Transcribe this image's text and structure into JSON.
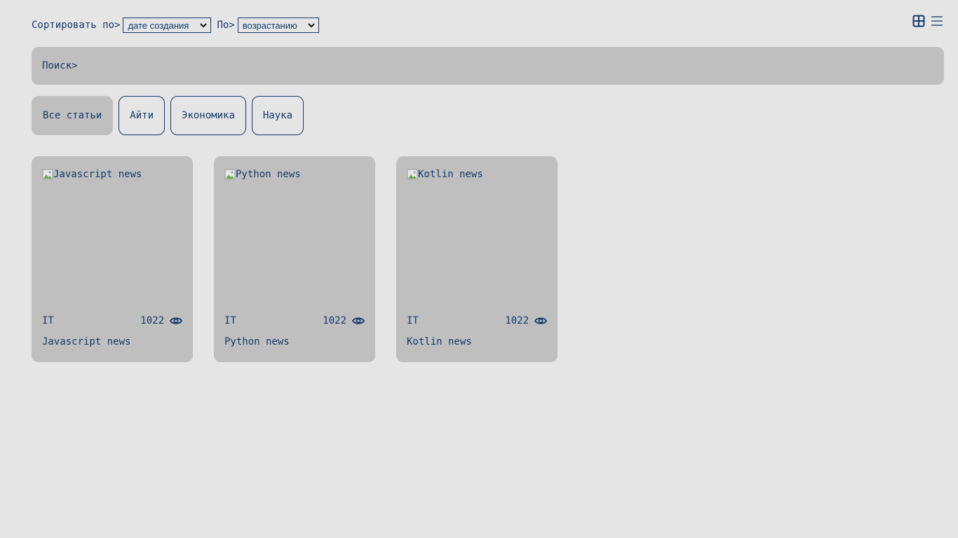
{
  "sort": {
    "label": "Сортировать по>",
    "field_value": "дате создания",
    "order_label": "По>",
    "order_value": "возрастанию"
  },
  "view_toggle": {
    "grid_icon": "grid-view-icon",
    "list_icon": "list-view-icon"
  },
  "search": {
    "placeholder": "Поиск>"
  },
  "filters": [
    {
      "label": "Все статьи",
      "active": true
    },
    {
      "label": "Айти",
      "active": false
    },
    {
      "label": "Экономика",
      "active": false
    },
    {
      "label": "Наука",
      "active": false
    }
  ],
  "articles": [
    {
      "image_alt": "Javascript news",
      "category": "IT",
      "views": "1022",
      "title": "Javascript news"
    },
    {
      "image_alt": "Python news",
      "category": "IT",
      "views": "1022",
      "title": "Python news"
    },
    {
      "image_alt": "Kotlin news",
      "category": "IT",
      "views": "1022",
      "title": "Kotlin news"
    }
  ],
  "colors": {
    "background": "#e5e5e5",
    "surface": "#bfbfbf",
    "text": "#143a6b"
  }
}
